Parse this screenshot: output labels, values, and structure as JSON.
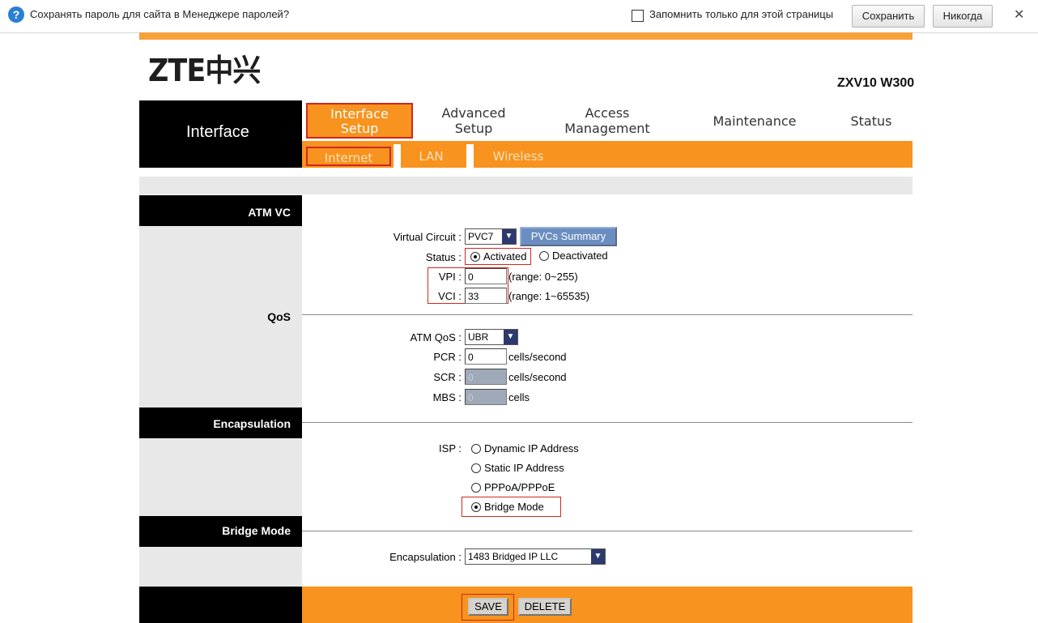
{
  "password_bar": {
    "message": "Сохранять пароль для сайта в Менеджере паролей?",
    "checkbox_label": "Запомнить только для этой страницы",
    "save_label": "Сохранить",
    "never_label": "Никогда",
    "close_glyph": "✕",
    "icon": "info-icon"
  },
  "header": {
    "logo": "ZTE中兴",
    "model": "ZXV10 W300"
  },
  "nav": {
    "section_title": "Interface",
    "tabs": [
      {
        "label": "Interface Setup",
        "line1": "Interface",
        "line2": "Setup",
        "active": true
      },
      {
        "label": "Advanced Setup",
        "line1": "Advanced",
        "line2": "Setup"
      },
      {
        "label": "Access Management",
        "line1": "Access",
        "line2": "Management"
      },
      {
        "label": "Maintenance"
      },
      {
        "label": "Status"
      }
    ],
    "subtabs": [
      {
        "label": "Internet",
        "active": true
      },
      {
        "label": "LAN"
      },
      {
        "label": "Wireless"
      }
    ]
  },
  "sections": {
    "atm_vc": "ATM VC",
    "qos": "QoS",
    "encapsulation": "Encapsulation",
    "bridge_mode": "Bridge Mode"
  },
  "atm": {
    "virtual_circuit_label": "Virtual Circuit :",
    "virtual_circuit_value": "PVC7",
    "pvcs_summary_label": "PVCs Summary",
    "status_label": "Status :",
    "status_options": [
      "Activated",
      "Deactivated"
    ],
    "status_selected": "Activated",
    "vpi_label": "VPI :",
    "vpi_value": "0",
    "vpi_range": "(range: 0~255)",
    "vci_label": "VCI :",
    "vci_value": "33",
    "vci_range": "(range: 1~65535)"
  },
  "qos": {
    "atm_qos_label": "ATM QoS :",
    "atm_qos_value": "UBR",
    "pcr_label": "PCR :",
    "pcr_value": "0",
    "pcr_unit": "cells/second",
    "scr_label": "SCR :",
    "scr_value": "0",
    "scr_unit": "cells/second",
    "mbs_label": "MBS :",
    "mbs_value": "0",
    "mbs_unit": "cells"
  },
  "isp": {
    "label": "ISP :",
    "options": [
      "Dynamic IP Address",
      "Static IP Address",
      "PPPoA/PPPoE",
      "Bridge Mode"
    ],
    "selected": "Bridge Mode"
  },
  "bridge": {
    "encapsulation_label": "Encapsulation :",
    "encapsulation_value": "1483 Bridged IP LLC"
  },
  "footer": {
    "save_label": "SAVE",
    "delete_label": "DELETE"
  },
  "colors": {
    "orange": "#f7931e",
    "black": "#000000",
    "highlight_red": "#d0271e",
    "disabled_input": "#9fa9b8"
  }
}
